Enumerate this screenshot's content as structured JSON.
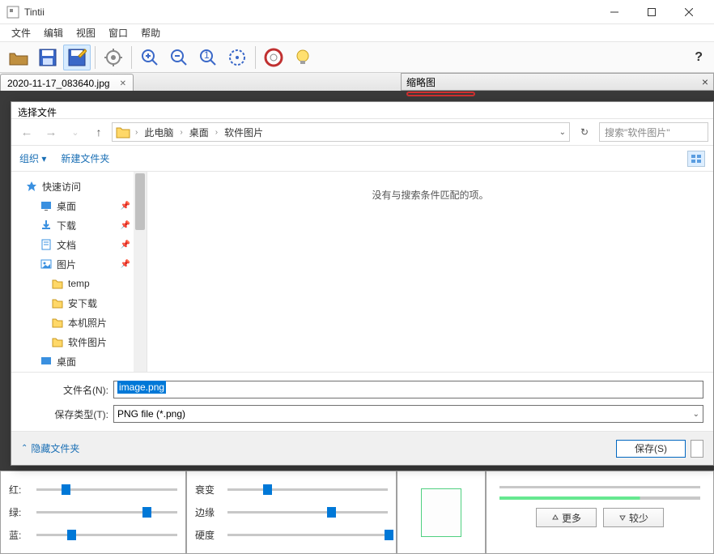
{
  "window": {
    "title": "Tintii"
  },
  "menu": {
    "file": "文件",
    "edit": "编辑",
    "view": "视图",
    "window": "窗口",
    "help": "帮助"
  },
  "tab": {
    "name": "2020-11-17_083640.jpg"
  },
  "panel": {
    "thumbnail": "缩略图"
  },
  "dialog": {
    "title": "选择文件",
    "organize": "组织",
    "newfolder": "新建文件夹",
    "search_placeholder": "搜索\"软件图片\"",
    "breadcrumb": {
      "pc": "此电脑",
      "desktop": "桌面",
      "folder": "软件图片"
    },
    "tree": {
      "quick": "快速访问",
      "desktop": "桌面",
      "downloads": "下载",
      "documents": "文档",
      "pictures": "图片",
      "temp": "temp",
      "andl": "安下载",
      "localphotos": "本机照片",
      "softpics": "软件图片",
      "desk2": "桌面"
    },
    "empty": "没有与搜索条件匹配的项。",
    "filename_label": "文件名(N):",
    "filename_value": "image.png",
    "filetype_label": "保存类型(T):",
    "filetype_value": "PNG file (*.png)",
    "hide_folders": "隐藏文件夹",
    "save": "保存(S)"
  },
  "sliders": {
    "red": "红:",
    "green": "绿:",
    "blue": "蓝:",
    "decay": "衰变",
    "edge": "边缘",
    "hard": "硬度",
    "more": "更多",
    "less": "较少"
  }
}
